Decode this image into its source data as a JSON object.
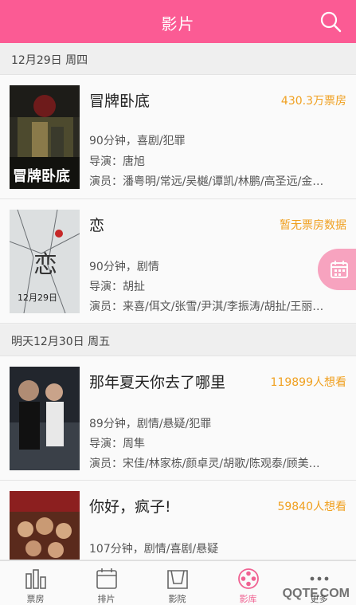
{
  "header": {
    "title": "影片",
    "search_icon": "search-icon"
  },
  "sections": [
    {
      "date": "12月29日 周四"
    },
    {
      "date": "明天12月30日 周五"
    }
  ],
  "movies": [
    {
      "title": "冒牌卧底",
      "stat": "430.3万票房",
      "info": "90分钟，喜剧/犯罪",
      "director": "导演：唐旭",
      "actors": "演员：潘粤明/常远/吴樾/谭凯/林鹏/高圣远/金…",
      "poster_text": "冒牌卧底"
    },
    {
      "title": "恋",
      "stat": "暂无票房数据",
      "info": "90分钟，剧情",
      "director": "导演：胡扯",
      "actors": "演员：来喜/佴文/张雪/尹淇/李振涛/胡扯/王丽…",
      "poster_text": "恋",
      "poster_date": "12月29日"
    },
    {
      "title": "那年夏天你去了哪里",
      "stat": "119899人想看",
      "info": "89分钟，剧情/悬疑/犯罪",
      "director": "导演：周隼",
      "actors": "演员：宋佳/林家栋/颜卓灵/胡歌/陈观泰/顾美…"
    },
    {
      "title": "你好，疯子!",
      "stat": "59840人想看",
      "info": "107分钟，剧情/喜剧/悬疑"
    }
  ],
  "fab": {
    "icon": "calendar-icon"
  },
  "tabs": [
    {
      "label": "票房",
      "icon": "bar-chart-icon",
      "active": false
    },
    {
      "label": "排片",
      "icon": "schedule-icon",
      "active": false
    },
    {
      "label": "影院",
      "icon": "cinema-icon",
      "active": false
    },
    {
      "label": "影库",
      "icon": "film-reel-icon",
      "active": true
    },
    {
      "label": "更多",
      "icon": "more-icon",
      "active": false
    }
  ],
  "watermark": "QQTF.COM",
  "colors": {
    "brand": "#fb5b94",
    "stat": "#f0a020",
    "active_tab": "#f06292"
  }
}
